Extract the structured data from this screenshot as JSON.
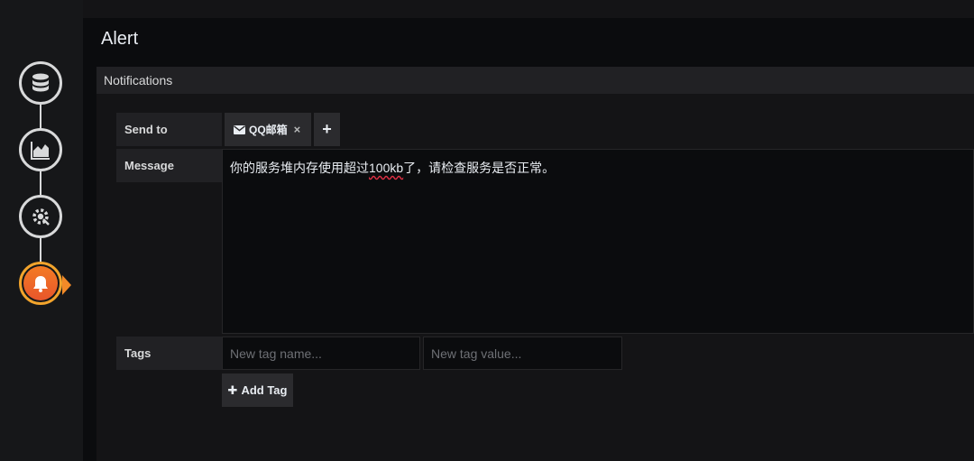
{
  "rail": {
    "steps": [
      {
        "icon": "database-icon"
      },
      {
        "icon": "chart-icon"
      },
      {
        "icon": "settings-icon"
      },
      {
        "icon": "bell-icon",
        "active": true
      }
    ],
    "accent_color": "#f28a28"
  },
  "panel": {
    "title": "Alert",
    "section_title": "Notifications"
  },
  "form": {
    "send_to_label": "Send to",
    "channel_chip": "QQ邮箱",
    "chip_remove": "×",
    "add_channel": "+",
    "message_label": "Message",
    "message_prefix": "你的服务堆内存使用超过",
    "message_misspelled": "100kb",
    "message_suffix": "了，请检查服务是否正常。",
    "tags_label": "Tags",
    "tag_name_placeholder": "New tag name...",
    "tag_value_placeholder": "New tag value...",
    "add_tag_label": "Add Tag"
  }
}
